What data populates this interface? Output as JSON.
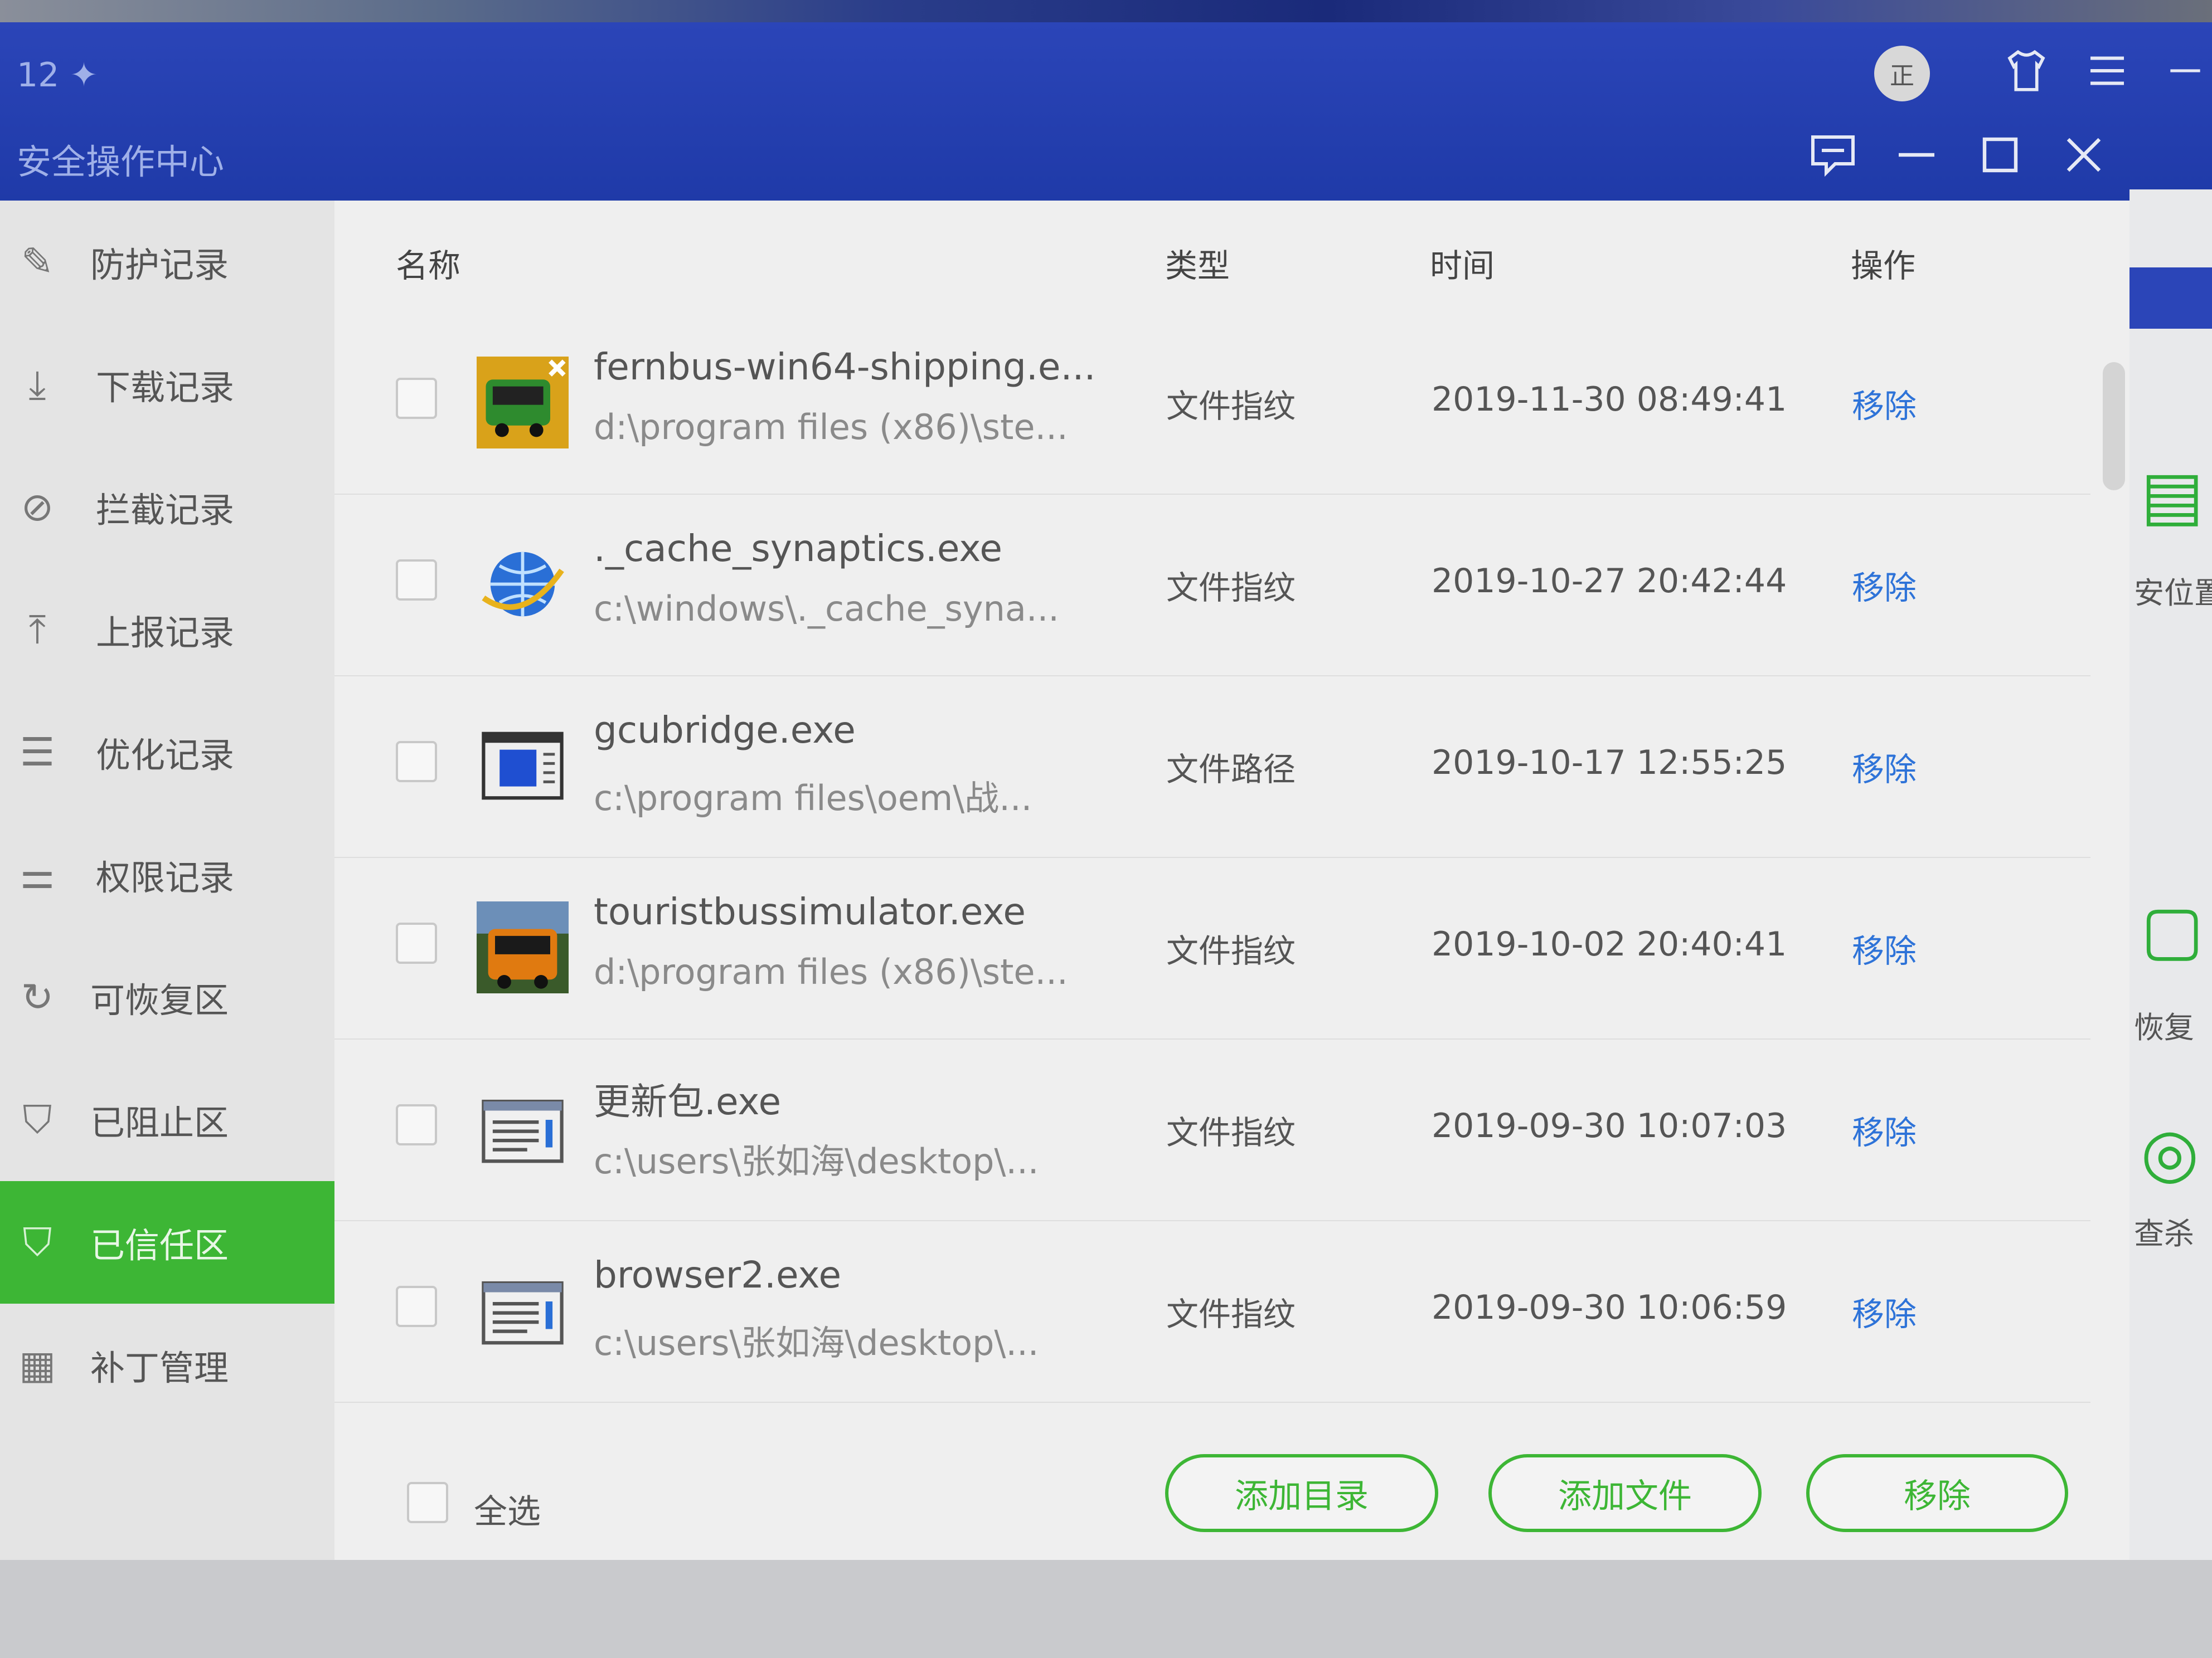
{
  "titlebar": {
    "small_label": "12 ✦",
    "app_title": "安全操作中心",
    "avatar_char": "正"
  },
  "sidebar": {
    "items": [
      {
        "label": "防护记录",
        "icon": "edit-icon"
      },
      {
        "label": "下载记录",
        "icon": "download-icon"
      },
      {
        "label": "拦截记录",
        "icon": "block-icon"
      },
      {
        "label": "上报记录",
        "icon": "upload-icon"
      },
      {
        "label": "优化记录",
        "icon": "optimize-icon"
      },
      {
        "label": "权限记录",
        "icon": "permission-icon"
      },
      {
        "label": "可恢复区",
        "icon": "restore-icon"
      },
      {
        "label": "已阻止区",
        "icon": "shield-icon"
      },
      {
        "label": "已信任区",
        "icon": "trusted-shield-icon",
        "active": true
      },
      {
        "label": "补丁管理",
        "icon": "patch-icon"
      }
    ]
  },
  "table": {
    "headers": {
      "name": "名称",
      "type": "类型",
      "time": "时间",
      "action": "操作"
    },
    "rows": [
      {
        "name": "fernbus-win64-shipping.e...",
        "path": "d:\\program files (x86)\\ste...",
        "type": "文件指纹",
        "time": "2019-11-30 08:49:41",
        "action": "移除",
        "icon": "bus-game-icon"
      },
      {
        "name": "._cache_synaptics.exe",
        "path": "c:\\windows\\._cache_syna...",
        "type": "文件指纹",
        "time": "2019-10-27 20:42:44",
        "action": "移除",
        "icon": "globe-icon"
      },
      {
        "name": "gcubridge.exe",
        "path": "c:\\program files\\oem\\战...",
        "type": "文件路径",
        "time": "2019-10-17 12:55:25",
        "action": "移除",
        "icon": "window-app-icon"
      },
      {
        "name": "touristbussimulator.exe",
        "path": "d:\\program files (x86)\\ste...",
        "type": "文件指纹",
        "time": "2019-10-02 20:40:41",
        "action": "移除",
        "icon": "tourist-bus-icon"
      },
      {
        "name": "更新包.exe",
        "path": "c:\\users\\张如海\\desktop\\...",
        "type": "文件指纹",
        "time": "2019-09-30 10:07:03",
        "action": "移除",
        "icon": "exe-file-icon"
      },
      {
        "name": "browser2.exe",
        "path": "c:\\users\\张如海\\desktop\\...",
        "type": "文件指纹",
        "time": "2019-09-30 10:06:59",
        "action": "移除",
        "icon": "exe-file-icon"
      }
    ]
  },
  "footer": {
    "select_all": "全选",
    "add_dir": "添加目录",
    "add_file": "添加文件",
    "remove": "移除"
  },
  "background_panel": {
    "labels": [
      "安位置",
      "恢复",
      "查杀"
    ]
  },
  "colors": {
    "titlebar_blue": "#2b45b8",
    "accent_green": "#3db635",
    "link_blue": "#2e73d8"
  }
}
